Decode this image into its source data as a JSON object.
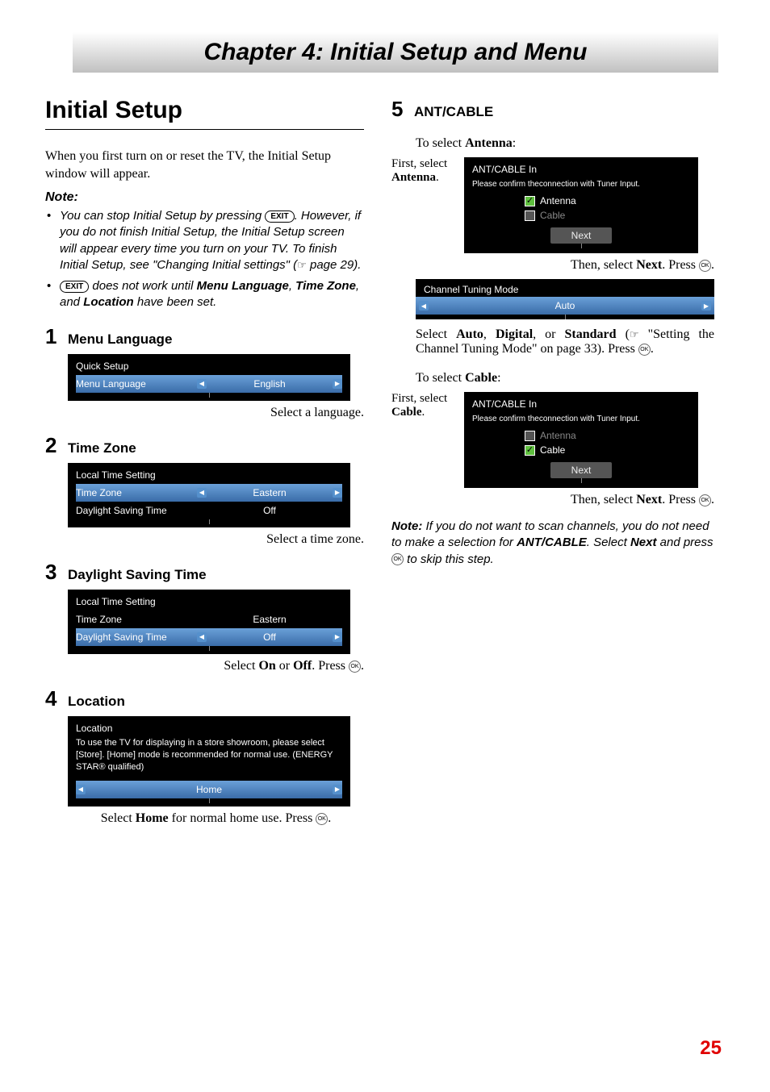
{
  "chapter_title": "Chapter 4: Initial Setup and Menu",
  "section_heading": "Initial Setup",
  "intro": "When you first turn on or reset the TV, the Initial Setup window will appear.",
  "note_label": "Note:",
  "notes": {
    "n1a": "You can stop Initial Setup by pressing ",
    "n1b": ". However, if you do not finish Initial Setup, the Initial Setup screen will appear every time you turn on your TV. To finish Initial Setup, see \"Changing Initial settings\" (",
    "n1c": " page 29).",
    "n2a": " does not work until ",
    "n2b": "Menu Language",
    "n2c": ", ",
    "n2d": "Time Zone",
    "n2e": ", and ",
    "n2f": "Location",
    "n2g": " have been set."
  },
  "icons": {
    "exit": "EXIT",
    "ok": "OK",
    "hand": "☞"
  },
  "steps": {
    "s1": {
      "num": "1",
      "title": "Menu Language",
      "osd_title": "Quick Setup",
      "row_label": "Menu Language",
      "row_value": "English",
      "caption": "Select a language."
    },
    "s2": {
      "num": "2",
      "title": "Time Zone",
      "osd_title": "Local Time Setting",
      "row1_label": "Time Zone",
      "row1_value": "Eastern",
      "row2_label": "Daylight Saving Time",
      "row2_value": "Off",
      "caption": "Select a time zone."
    },
    "s3": {
      "num": "3",
      "title": "Daylight Saving Time",
      "osd_title": "Local Time Setting",
      "row1_label": "Time Zone",
      "row1_value": "Eastern",
      "row2_label": "Daylight Saving Time",
      "row2_value": "Off",
      "cap_a": "Select ",
      "cap_b": "On",
      "cap_c": " or ",
      "cap_d": "Off",
      "cap_e": ". Press "
    },
    "s4": {
      "num": "4",
      "title": "Location",
      "osd_title": "Location",
      "osd_text": "To use the TV for displaying in a store showroom, please select [Store]. [Home] mode is recommended for normal use. (ENERGY STAR® qualified)",
      "row_value": "Home",
      "cap_a": "Select ",
      "cap_b": "Home",
      "cap_c": " for normal home use. Press "
    },
    "s5": {
      "num": "5",
      "title": "ANT/CABLE",
      "to_select_ant_a": "To select ",
      "to_select_ant_b": "Antenna",
      "to_select_ant_c": ":",
      "side_ant_a": "First, select ",
      "side_ant_b": "Antenna",
      "side_ant_c": ".",
      "ant_title": "ANT/CABLE In",
      "ant_sub": "Please confirm theconnection with Tuner Input.",
      "opt_antenna": "Antenna",
      "opt_cable": "Cable",
      "next": "Next",
      "then_a": "Then, select ",
      "then_b": "Next",
      "then_c": ". Press ",
      "ctm_title": "Channel Tuning Mode",
      "ctm_value": "Auto",
      "ctm_cap_a": "Select ",
      "ctm_cap_b": "Auto",
      "ctm_cap_c": ", ",
      "ctm_cap_d": "Digital",
      "ctm_cap_e": ", or ",
      "ctm_cap_f": "Standard",
      "ctm_cap_g": " (",
      "ctm_cap_h": " \"Setting the Channel Tuning Mode\" on page 33). Press ",
      "to_select_cbl_a": "To select ",
      "to_select_cbl_b": "Cable",
      "to_select_cbl_c": ":",
      "side_cbl_a": "First, select ",
      "side_cbl_b": "Cable",
      "side_cbl_c": ".",
      "note_a": "Note:",
      "note_b": " If you do not want to scan channels, you do not need to make a selection for ",
      "note_c": "ANT/CABLE",
      "note_d": ". Select ",
      "note_e": "Next",
      "note_f": " and press ",
      "note_g": " to skip this step."
    }
  },
  "page_number": "25"
}
